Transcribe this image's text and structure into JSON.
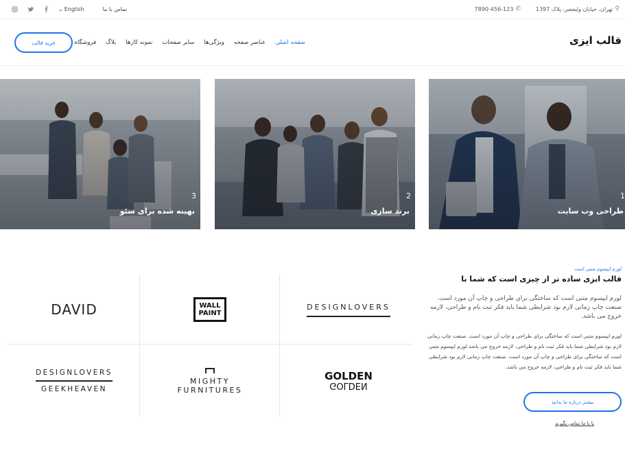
{
  "topbar": {
    "address": "تهران، خیابان ولیعصر، پلاک 1397",
    "phone": "7890-456-123",
    "language": "English",
    "contact": "تماس با ما",
    "social": [
      "facebook-icon",
      "twitter-icon",
      "instagram-icon"
    ]
  },
  "header": {
    "logo": "قالب ایزی",
    "nav": [
      "صفحه اصلی",
      "عناصر صفحه",
      "ویژگی‌ها",
      "سایر صفحات",
      "نمونه کارها",
      "بلاگ",
      "فروشگاه"
    ],
    "buy_button": "خرید قالب"
  },
  "cards": [
    {
      "num": "1",
      "title": "طراحی وب سایت"
    },
    {
      "num": "2",
      "title": "برند سازی"
    },
    {
      "num": "3",
      "title": "بهینه شده برای سئو"
    }
  ],
  "about": {
    "kicker": "لورم ایپسوم متنی است",
    "headline": "قالب ایزی ساده تر از چیزی است که شما با",
    "lead": "لورم ایپسوم متنی است که ساختگی برای طراحی و چاپ آن مورد است. صنعت چاپ زمانی لازم بود شرایطی شما باید فکر ثبت نام و طراحی، لازمه خروج می باشد.",
    "body": "لورم ایپسوم متنی است که ساختگی برای طراحی و چاپ آن مورد است. صنعت چاپ زمانی لازم بود شرایطی شما باید فکر ثبت نام و طراحی، لازمه خروج می باشد.لورم ایپسوم متنی است که ساختگی برای طراحی و چاپ آن مورد است. صنعت چاپ زمانی لازم بود شرایطی شما باید فکر ثبت نام و طراحی، لازمه خروج می باشد.",
    "more_button": "بیشتر درباره ما بدانید",
    "contact_link": "یا با ما تماس بگیرید"
  },
  "logos": {
    "david": "DAVID",
    "wall_paint": [
      "WALL",
      "PAINT"
    ],
    "designlovers": "DESIGNLOVERS",
    "geekheaven": "GEEKHEAVEN",
    "mighty": [
      "MIGHTY",
      "FURNITURES"
    ],
    "golden": "GOLDEN"
  },
  "colors": {
    "accent": "#1e73e8"
  }
}
